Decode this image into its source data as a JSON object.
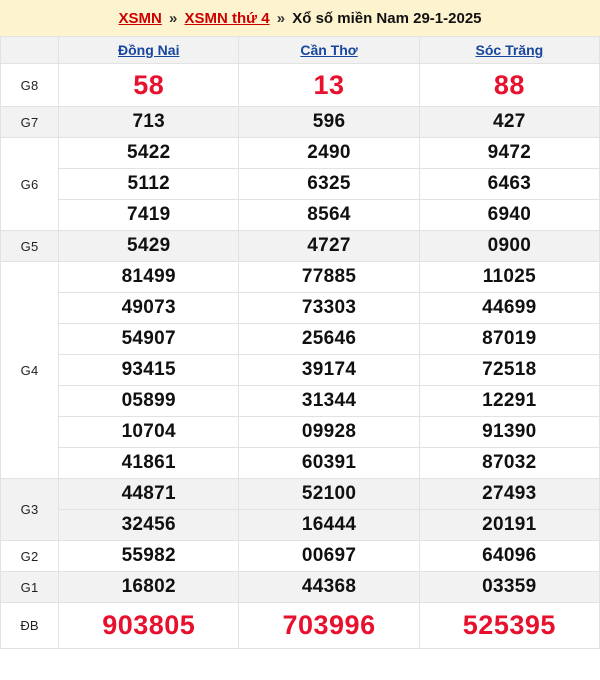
{
  "header": {
    "breadcrumb": [
      {
        "text": "XSMN",
        "type": "link"
      },
      {
        "text": "»",
        "type": "separator"
      },
      {
        "text": "XSMN thứ 4",
        "type": "link"
      },
      {
        "text": "»",
        "type": "separator"
      },
      {
        "text": "Xổ số miền Nam 29-1-2025",
        "type": "plain"
      }
    ],
    "link_color": "#cc0000",
    "banner_color": "#fdf3ce"
  },
  "table": {
    "corner_label": "",
    "columns": [
      "Đồng Nai",
      "Cần Thơ",
      "Sóc Trăng"
    ],
    "column_link_color": "#16469d",
    "highlight_color": "#e8112d",
    "row_shade_color": "#f2f2f2",
    "rows": [
      {
        "label": "G8",
        "style": "highlight",
        "shaded": false,
        "values": [
          [
            "58"
          ],
          [
            "13"
          ],
          [
            "88"
          ]
        ]
      },
      {
        "label": "G7",
        "style": "normal",
        "shaded": true,
        "values": [
          [
            "713"
          ],
          [
            "596"
          ],
          [
            "427"
          ]
        ]
      },
      {
        "label": "G6",
        "style": "normal",
        "shaded": false,
        "values": [
          [
            "5422",
            "5112",
            "7419"
          ],
          [
            "2490",
            "6325",
            "8564"
          ],
          [
            "9472",
            "6463",
            "6940"
          ]
        ]
      },
      {
        "label": "G5",
        "style": "normal",
        "shaded": true,
        "values": [
          [
            "5429"
          ],
          [
            "4727"
          ],
          [
            "0900"
          ]
        ]
      },
      {
        "label": "G4",
        "style": "normal",
        "shaded": false,
        "values": [
          [
            "81499",
            "49073",
            "54907",
            "93415",
            "05899",
            "10704",
            "41861"
          ],
          [
            "77885",
            "73303",
            "25646",
            "39174",
            "31344",
            "09928",
            "60391"
          ],
          [
            "11025",
            "44699",
            "87019",
            "72518",
            "12291",
            "91390",
            "87032"
          ]
        ]
      },
      {
        "label": "G3",
        "style": "normal",
        "shaded": true,
        "values": [
          [
            "44871",
            "32456"
          ],
          [
            "52100",
            "16444"
          ],
          [
            "27493",
            "20191"
          ]
        ]
      },
      {
        "label": "G2",
        "style": "normal",
        "shaded": false,
        "values": [
          [
            "55982"
          ],
          [
            "00697"
          ],
          [
            "64096"
          ]
        ]
      },
      {
        "label": "G1",
        "style": "normal",
        "shaded": true,
        "values": [
          [
            "16802"
          ],
          [
            "44368"
          ],
          [
            "03359"
          ]
        ]
      },
      {
        "label": "ĐB",
        "style": "highlight",
        "shaded": false,
        "values": [
          [
            "903805"
          ],
          [
            "703996"
          ],
          [
            "525395"
          ]
        ]
      }
    ]
  }
}
